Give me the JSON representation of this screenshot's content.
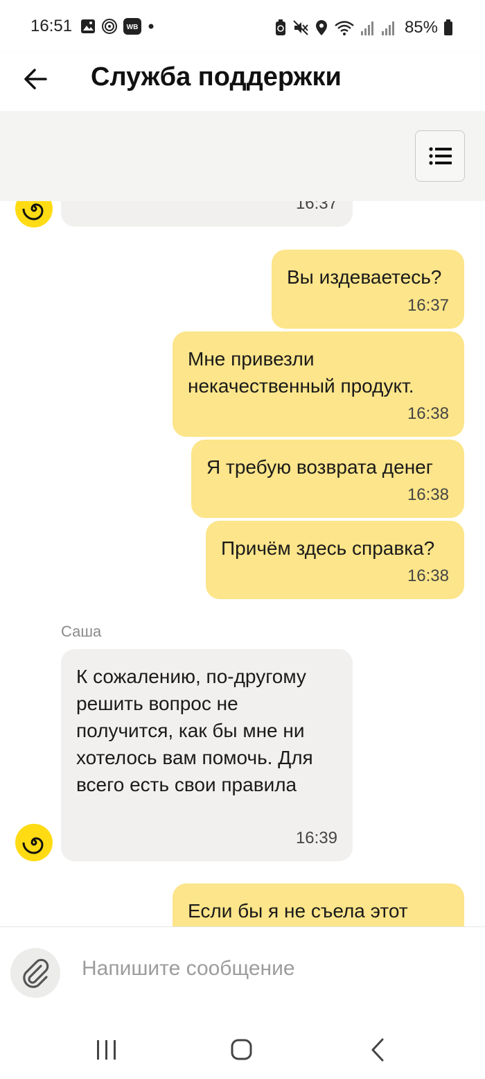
{
  "status": {
    "time": "16:51",
    "battery": "85%",
    "left_icons": [
      "gallery-icon",
      "spiral-icon",
      "wb-icon",
      "dot-icon"
    ],
    "right_icons": [
      "battery-saver-icon",
      "mute-icon",
      "location-icon",
      "wifi-icon",
      "signal-icon",
      "signal-icon"
    ],
    "wb_badge": "WB"
  },
  "header": {
    "title": "Служба поддержки",
    "back_icon": "arrow-left-icon",
    "menu_icon": "list-icon"
  },
  "chat": {
    "first_partial_time": "16:37",
    "outgoing_1": [
      {
        "text": "Вы издеваетесь?",
        "time": "16:37"
      },
      {
        "text": "Мне привезли некачественный продукт.",
        "time": "16:38"
      },
      {
        "text": "Я требую возврата денег",
        "time": "16:38"
      },
      {
        "text": "Причём здесь справка?",
        "time": "16:38"
      }
    ],
    "operator_name": "Саша",
    "incoming": {
      "text": "К сожалению, по-другому решить вопрос не получится, как бы мне ни хотелось вам помочь. Для всего есть свои правила",
      "time": "16:39"
    },
    "outgoing_partial": "Если бы я не съела этот"
  },
  "composer": {
    "placeholder": "Напишите сообщение",
    "attach_icon": "paperclip-icon"
  },
  "colors": {
    "outgoing_bubble": "#fce58a",
    "incoming_bubble": "#f1f0ee",
    "avatar": "#ffdb14",
    "background": "#ffffff"
  },
  "navbar": {
    "icons": [
      "recent-apps-icon",
      "home-icon",
      "back-icon"
    ]
  }
}
